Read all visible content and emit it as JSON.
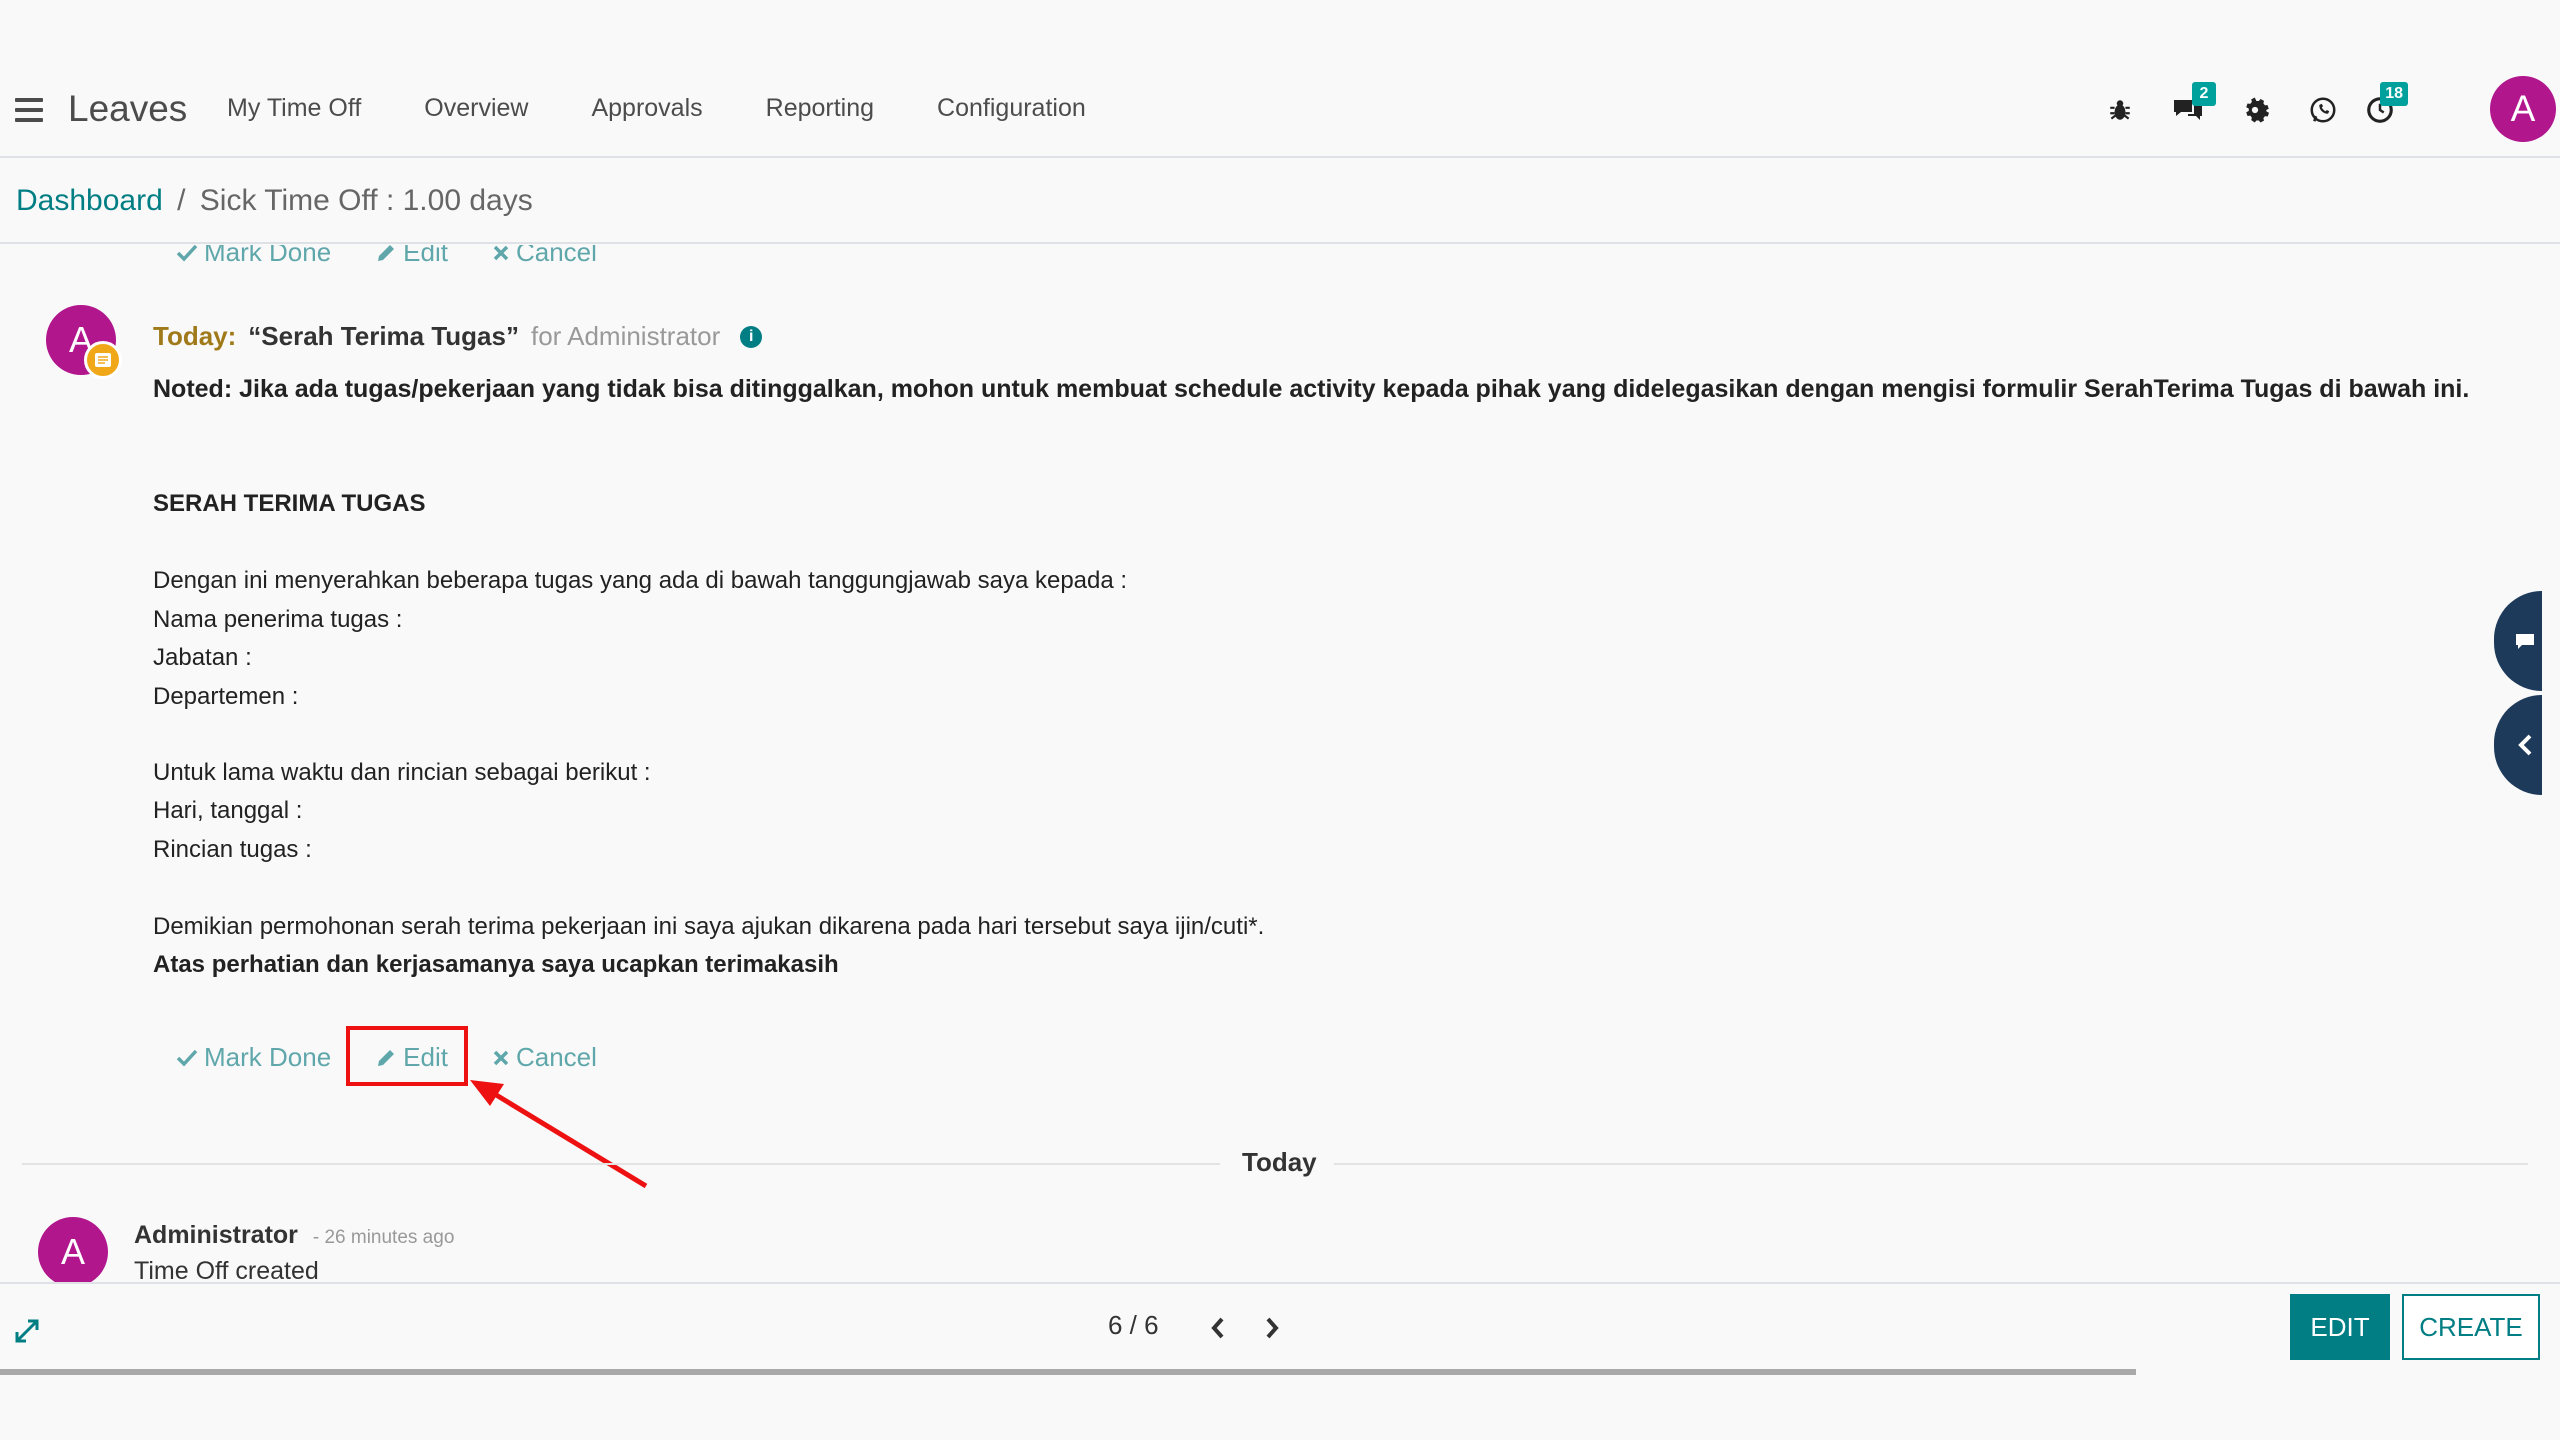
{
  "app": {
    "title": "Leaves",
    "menu": [
      "My Time Off",
      "Overview",
      "Approvals",
      "Reporting",
      "Configuration"
    ]
  },
  "systray": {
    "bug_icon": "bug-icon",
    "messages_icon": "chat-bubbles-icon",
    "messages_count": "2",
    "settings_icon": "gear-icon",
    "whatsapp_icon": "whatsapp-icon",
    "activity_icon": "clock-icon",
    "activity_count": "18",
    "user_initial": "A"
  },
  "breadcrumb": {
    "parent": "Dashboard",
    "separator": "/",
    "current": "Sick Time Off : 1.00 days"
  },
  "actions": {
    "mark_done": "Mark Done",
    "edit": "Edit",
    "cancel": "Cancel"
  },
  "activity": {
    "avatar_initial": "A",
    "today_label": "Today:",
    "title": "“Serah Terima Tugas”",
    "for_text": "for Administrator",
    "info_symbol": "i",
    "note": "Noted: Jika ada tugas/pekerjaan yang tidak bisa ditinggalkan, mohon untuk membuat schedule activity kepada pihak yang didelegasikan dengan mengisi formulir SerahTerima Tugas di bawah ini.",
    "heading": "SERAH TERIMA TUGAS",
    "lines": [
      "Dengan ini menyerahkan beberapa tugas yang ada di bawah tanggungjawab saya kepada :",
      "Nama penerima tugas :",
      "Jabatan :",
      "Departemen :",
      "Untuk lama waktu dan rincian sebagai berikut :",
      "Hari, tanggal :",
      "Rincian tugas :",
      "Demikian permohonan serah terima pekerjaan ini saya ajukan dikarena pada hari tersebut saya ijin/cuti*.",
      "Atas perhatian dan kerjasamanya saya ucapkan terimakasih"
    ]
  },
  "divider": {
    "label": "Today"
  },
  "message": {
    "avatar_initial": "A",
    "author": "Administrator",
    "time": "- 26 minutes ago",
    "body": "Time Off created"
  },
  "pager": {
    "value": "6 / 6"
  },
  "buttons": {
    "edit": "EDIT",
    "create": "CREATE"
  },
  "colors": {
    "accent": "#017e84",
    "avatar": "#b1168c",
    "highlight": "#ee1111"
  }
}
